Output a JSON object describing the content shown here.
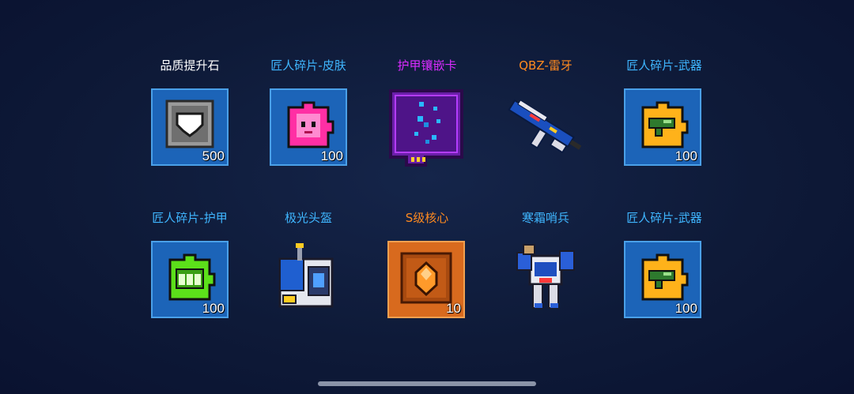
{
  "rows": [
    [
      {
        "label": "品质提升石",
        "color": "#ffffff",
        "qty": "500"
      },
      {
        "label": "匠人碎片-皮肤",
        "color": "#3fb6ff",
        "qty": "100"
      },
      {
        "label": "护甲镶嵌卡",
        "color": "#d92cff",
        "qty": ""
      },
      {
        "label": "QBZ-雷牙",
        "color": "#ff8a1f",
        "qty": ""
      },
      {
        "label": "匠人碎片-武器",
        "color": "#3fb6ff",
        "qty": "100"
      }
    ],
    [
      {
        "label": "匠人碎片-护甲",
        "color": "#3fb6ff",
        "qty": "100"
      },
      {
        "label": "极光头盔",
        "color": "#3fb6ff",
        "qty": ""
      },
      {
        "label": "S级核心",
        "color": "#ff8a1f",
        "qty": "10"
      },
      {
        "label": "寒霜哨兵",
        "color": "#3fb6ff",
        "qty": ""
      },
      {
        "label": "匠人碎片-武器",
        "color": "#3fb6ff",
        "qty": "100"
      }
    ]
  ],
  "colors": {
    "blue_label": "#3fb6ff",
    "purple_label": "#d92cff",
    "orange_label": "#ff8a1f",
    "tile_blue": "#1c64b8",
    "tile_orange": "#d86a1e"
  },
  "icons": [
    "shield-gem-icon",
    "skin-puzzle-icon",
    "armor-inlay-card-icon",
    "rifle-icon",
    "weapon-puzzle-icon",
    "armor-puzzle-icon",
    "helmet-icon",
    "core-gem-icon",
    "frost-sentinel-icon",
    "weapon-puzzle-icon"
  ]
}
